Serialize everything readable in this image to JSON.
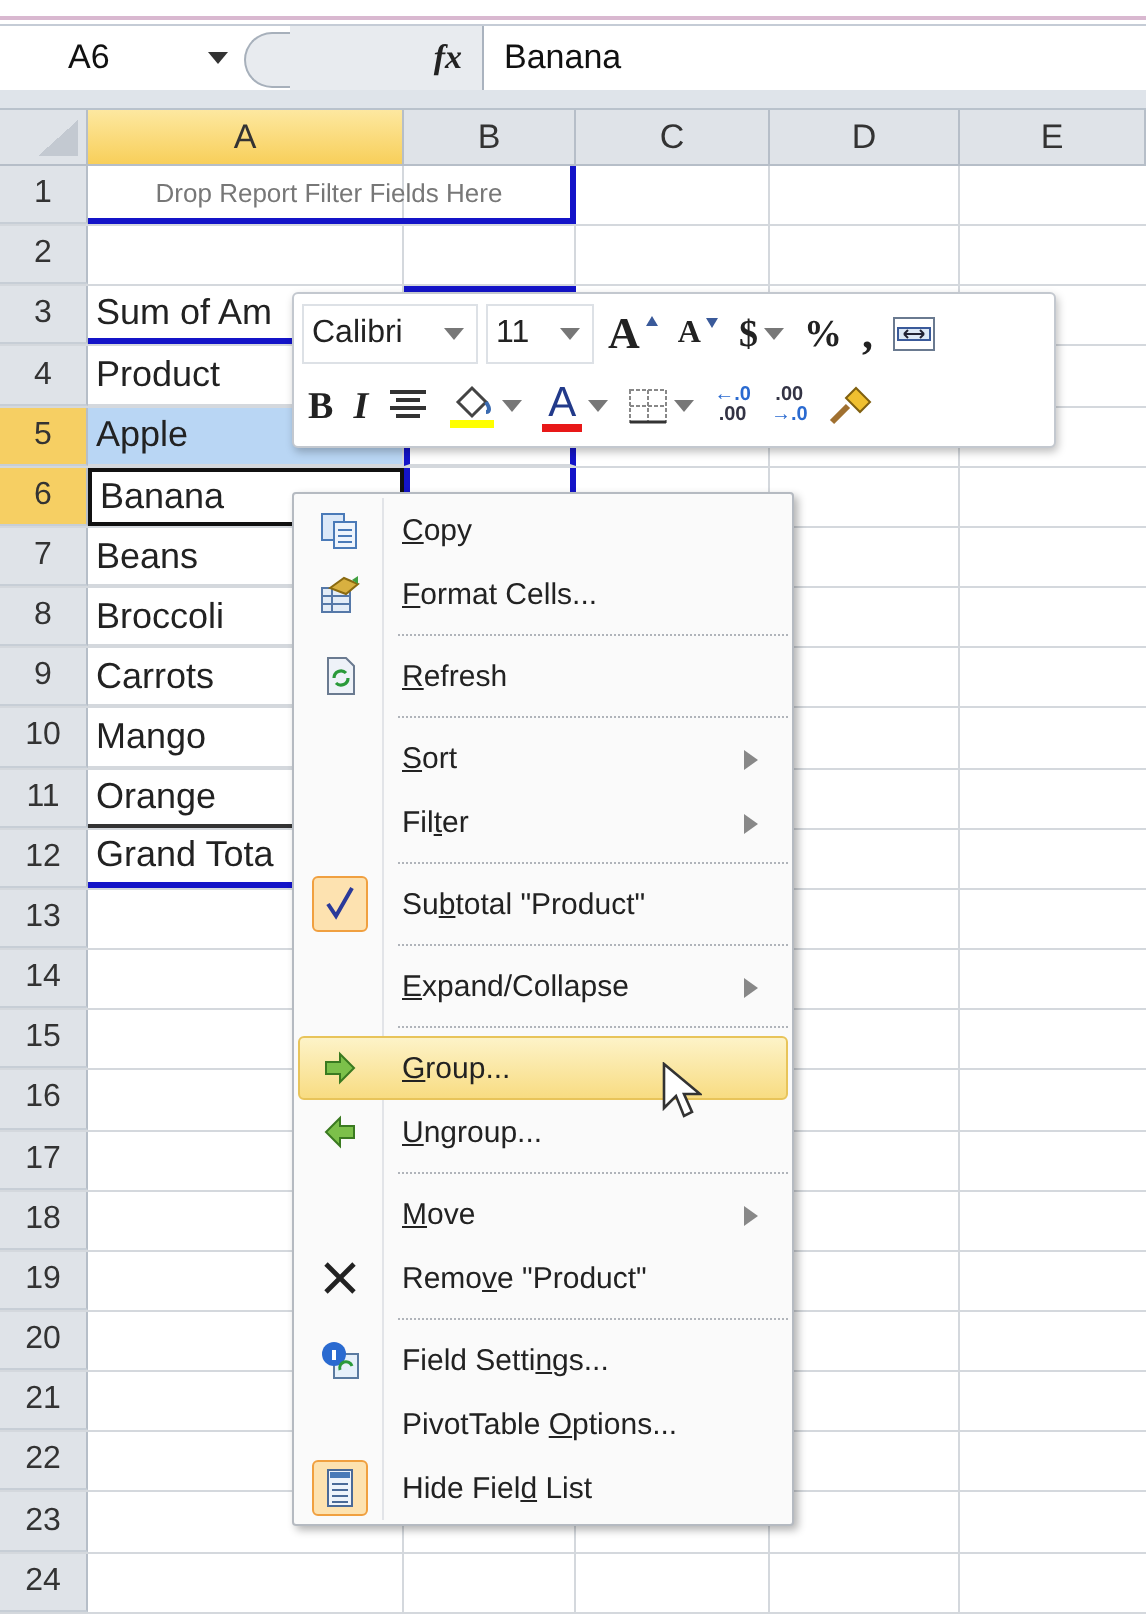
{
  "formula_bar": {
    "name_box": "A6",
    "fx": "fx",
    "formula": "Banana"
  },
  "columns": [
    {
      "label": "A",
      "selected": true
    },
    {
      "label": "B",
      "selected": false
    },
    {
      "label": "C",
      "selected": false
    },
    {
      "label": "D",
      "selected": false
    },
    {
      "label": "E",
      "selected": false
    }
  ],
  "rows": [
    {
      "header": "1",
      "selected": false,
      "kind": "filter-drop",
      "text": "Drop Report Filter Fields Here"
    },
    {
      "header": "2",
      "selected": false,
      "kind": "empty"
    },
    {
      "header": "3",
      "selected": false,
      "kind": "value-header",
      "text": "Sum of Am"
    },
    {
      "header": "4",
      "selected": false,
      "kind": "label-header",
      "text": "Product"
    },
    {
      "header": "5",
      "selected": true,
      "kind": "item",
      "text": "Apple",
      "highlighted": true,
      "active": false
    },
    {
      "header": "6",
      "selected": true,
      "kind": "item",
      "text": "Banana",
      "highlighted": false,
      "active": true
    },
    {
      "header": "7",
      "selected": false,
      "kind": "item",
      "text": "Beans",
      "highlighted": false,
      "active": false
    },
    {
      "header": "8",
      "selected": false,
      "kind": "item",
      "text": "Broccoli",
      "highlighted": false,
      "active": false
    },
    {
      "header": "9",
      "selected": false,
      "kind": "item",
      "text": "Carrots",
      "highlighted": false,
      "active": false
    },
    {
      "header": "10",
      "selected": false,
      "kind": "item",
      "text": "Mango",
      "highlighted": false,
      "active": false
    },
    {
      "header": "11",
      "selected": false,
      "kind": "last-item",
      "text": "Orange",
      "highlighted": false,
      "active": false
    },
    {
      "header": "12",
      "selected": false,
      "kind": "grand-total",
      "text": "Grand Tota"
    },
    {
      "header": "13",
      "selected": false,
      "kind": "empty"
    },
    {
      "header": "14",
      "selected": false,
      "kind": "empty"
    },
    {
      "header": "15",
      "selected": false,
      "kind": "empty"
    },
    {
      "header": "16",
      "selected": false,
      "kind": "empty"
    },
    {
      "header": "17",
      "selected": false,
      "kind": "empty"
    },
    {
      "header": "18",
      "selected": false,
      "kind": "empty"
    },
    {
      "header": "19",
      "selected": false,
      "kind": "empty"
    },
    {
      "header": "20",
      "selected": false,
      "kind": "empty"
    },
    {
      "header": "21",
      "selected": false,
      "kind": "empty"
    },
    {
      "header": "22",
      "selected": false,
      "kind": "empty"
    },
    {
      "header": "23",
      "selected": false,
      "kind": "empty"
    },
    {
      "header": "24",
      "selected": false,
      "kind": "empty"
    }
  ],
  "mini_toolbar": {
    "font": "Calibri",
    "size": "11",
    "row1": [
      {
        "kind": "grow",
        "text": "A"
      },
      {
        "kind": "shrink",
        "text": "A"
      },
      {
        "kind": "currency",
        "text": "$",
        "dropdown": true
      },
      {
        "kind": "percent",
        "text": "%",
        "dropdown": false
      },
      {
        "kind": "comma",
        "text": ",",
        "dropdown": false
      },
      {
        "kind": "merge",
        "dropdown": false
      }
    ],
    "row2": [
      {
        "kind": "bold",
        "text": "B",
        "dropdown": false
      },
      {
        "kind": "italic",
        "text": "I",
        "dropdown": false
      },
      {
        "kind": "center",
        "dropdown": false
      },
      {
        "kind": "fill",
        "dropdown": true
      },
      {
        "kind": "font-color",
        "text": "A",
        "dropdown": true
      },
      {
        "kind": "borders",
        "dropdown": true
      },
      {
        "kind": "inc-decimal",
        "text": "←.0",
        "text2": ".00",
        "dropdown": false
      },
      {
        "kind": "dec-decimal",
        "text": ".00",
        "text2": "→.0",
        "dropdown": false
      },
      {
        "kind": "painter",
        "dropdown": false
      }
    ]
  },
  "context_menu": [
    {
      "kind": "copy",
      "key": "C",
      "post": "opy",
      "submenu": false,
      "checked": false,
      "highlighted": false
    },
    {
      "kind": "format",
      "key": "F",
      "post": "ormat Cells...",
      "submenu": false,
      "checked": false,
      "highlighted": false
    },
    {
      "kind": "separator"
    },
    {
      "kind": "refresh",
      "key": "R",
      "post": "efresh",
      "submenu": false,
      "checked": false,
      "highlighted": false
    },
    {
      "kind": "separator"
    },
    {
      "kind": "plain",
      "key": "S",
      "post": "ort",
      "submenu": true,
      "checked": false,
      "highlighted": false
    },
    {
      "kind": "plain",
      "pre": "Fil",
      "key": "t",
      "post": "er",
      "submenu": true,
      "checked": false,
      "highlighted": false
    },
    {
      "kind": "separator"
    },
    {
      "kind": "check",
      "pre": "Su",
      "key": "b",
      "post": "total \"Product\"",
      "submenu": false,
      "checked": true,
      "highlighted": false
    },
    {
      "kind": "separator"
    },
    {
      "kind": "plain",
      "key": "E",
      "post": "xpand/Collapse",
      "submenu": true,
      "checked": false,
      "highlighted": false
    },
    {
      "kind": "separator"
    },
    {
      "kind": "group",
      "key": "G",
      "post": "roup...",
      "submenu": false,
      "checked": false,
      "highlighted": true
    },
    {
      "kind": "ungroup",
      "key": "U",
      "post": "ngroup...",
      "submenu": false,
      "checked": false,
      "highlighted": false
    },
    {
      "kind": "separator"
    },
    {
      "kind": "plain",
      "key": "M",
      "post": "ove",
      "submenu": true,
      "checked": false,
      "highlighted": false
    },
    {
      "kind": "remove",
      "pre": "Remo",
      "key": "v",
      "post": "e \"Product\"",
      "submenu": false,
      "checked": false,
      "highlighted": false
    },
    {
      "kind": "separator"
    },
    {
      "kind": "settings",
      "pre": "Field Setti",
      "key": "n",
      "post": "gs...",
      "submenu": false,
      "checked": false,
      "highlighted": false
    },
    {
      "kind": "plain",
      "pre": "PivotTable ",
      "key": "O",
      "post": "ptions...",
      "submenu": false,
      "checked": false,
      "highlighted": false
    },
    {
      "kind": "fieldlist",
      "pre": "Hide Fiel",
      "key": "d",
      "post": " List",
      "submenu": false,
      "checked": true,
      "highlighted": false
    }
  ]
}
